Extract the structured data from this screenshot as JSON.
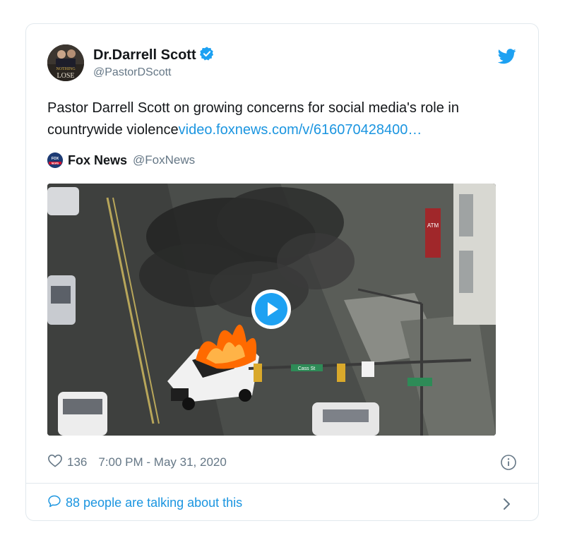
{
  "author": {
    "name": "Dr.Darrell Scott",
    "handle": "@PastorDScott",
    "avatar_text": "NOTHING LOSE"
  },
  "tweet": {
    "text": "Pastor Darrell Scott on growing concerns for social media's role in countrywide violence",
    "link": "video.foxnews.com/v/616070428400…"
  },
  "quoted": {
    "name": "Fox News",
    "handle": "@FoxNews",
    "icon_text": "FOX NEWS"
  },
  "media": {
    "type": "video",
    "description_icon": "play-icon",
    "street_sign": "Cass St",
    "atm_sign": "ATM"
  },
  "meta": {
    "likes": "136",
    "timestamp": "7:00 PM - May 31, 2020"
  },
  "footer": {
    "talking": "88 people are talking about this"
  },
  "colors": {
    "accent": "#1da1f2",
    "link": "#1b95e0",
    "muted": "#657786",
    "border": "#e1e8ed"
  }
}
